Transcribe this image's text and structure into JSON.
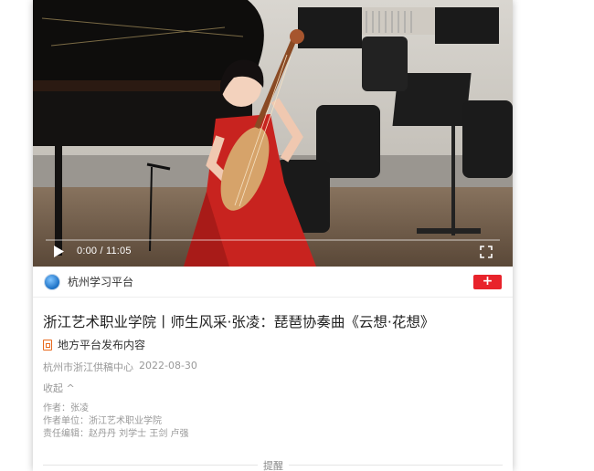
{
  "video": {
    "time": "0:00 / 11:05",
    "progress": 0
  },
  "source": {
    "name": "杭州学习平台",
    "follow_label": "+"
  },
  "article": {
    "title": "浙江艺术职业学院丨师生风采·张凌：琵琶协奏曲《云想·花想》",
    "badge": "地方平台发布内容",
    "origin": "杭州市浙江供稿中心",
    "date": "2022-08-30",
    "collapse_label": "收起 ^",
    "author": "作者：张凌",
    "unit": "作者单位：浙江艺术职业学院",
    "editors": "责任编辑：赵丹丹 刘学士 王剑 卢强",
    "notice": "提醒"
  },
  "colors": {
    "accent": "#e8232b",
    "badge": "#e86a1e"
  }
}
